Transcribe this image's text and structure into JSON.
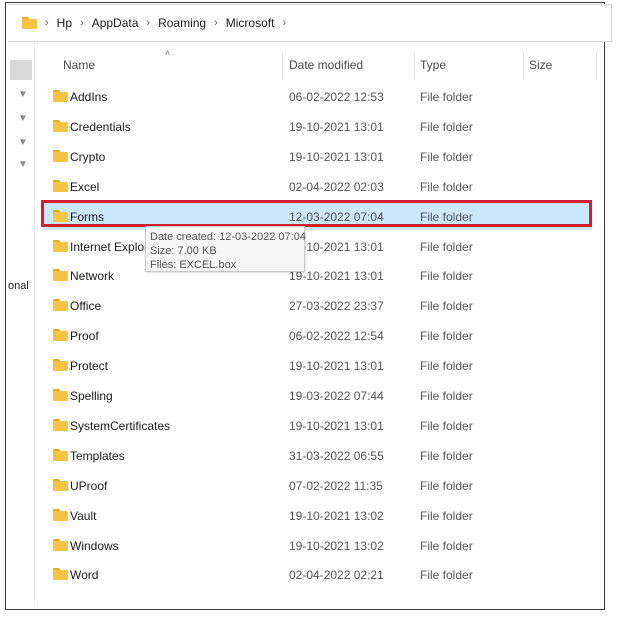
{
  "breadcrumb": [
    "Hp",
    "AppData",
    "Roaming",
    "Microsoft"
  ],
  "columns": {
    "name": "Name",
    "date": "Date modified",
    "type": "Type",
    "size": "Size"
  },
  "nav": {
    "partial_label": "onal"
  },
  "files": [
    {
      "name": "AddIns",
      "date": "06-02-2022 12:53",
      "type": "File folder"
    },
    {
      "name": "Credentials",
      "date": "19-10-2021 13:01",
      "type": "File folder"
    },
    {
      "name": "Crypto",
      "date": "19-10-2021 13:01",
      "type": "File folder"
    },
    {
      "name": "Excel",
      "date": "02-04-2022 02:03",
      "type": "File folder"
    },
    {
      "name": "Forms",
      "date": "12-03-2022 07:04",
      "type": "File folder"
    },
    {
      "name": "Internet Explorer",
      "date": "19-10-2021 13:01",
      "type": "File folder"
    },
    {
      "name": "Network",
      "date": "19-10-2021 13:01",
      "type": "File folder"
    },
    {
      "name": "Office",
      "date": "27-03-2022 23:37",
      "type": "File folder"
    },
    {
      "name": "Proof",
      "date": "06-02-2022 12:54",
      "type": "File folder"
    },
    {
      "name": "Protect",
      "date": "19-10-2021 13:01",
      "type": "File folder"
    },
    {
      "name": "Spelling",
      "date": "19-03-2022 07:44",
      "type": "File folder"
    },
    {
      "name": "SystemCertificates",
      "date": "19-10-2021 13:01",
      "type": "File folder"
    },
    {
      "name": "Templates",
      "date": "31-03-2022 06:55",
      "type": "File folder"
    },
    {
      "name": "UProof",
      "date": "07-02-2022 11:35",
      "type": "File folder"
    },
    {
      "name": "Vault",
      "date": "19-10-2021 13:02",
      "type": "File folder"
    },
    {
      "name": "Windows",
      "date": "19-10-2021 13:02",
      "type": "File folder"
    },
    {
      "name": "Word",
      "date": "02-04-2022 02:21",
      "type": "File folder"
    }
  ],
  "tooltip": {
    "created": "Date created: 12-03-2022 07:04",
    "size": "Size: 7.00 KB",
    "files": "Files: EXCEL.box"
  },
  "colors": {
    "selection": "#cce8ff",
    "highlight_border": "#d21f2a",
    "folder": "#f6c343"
  }
}
